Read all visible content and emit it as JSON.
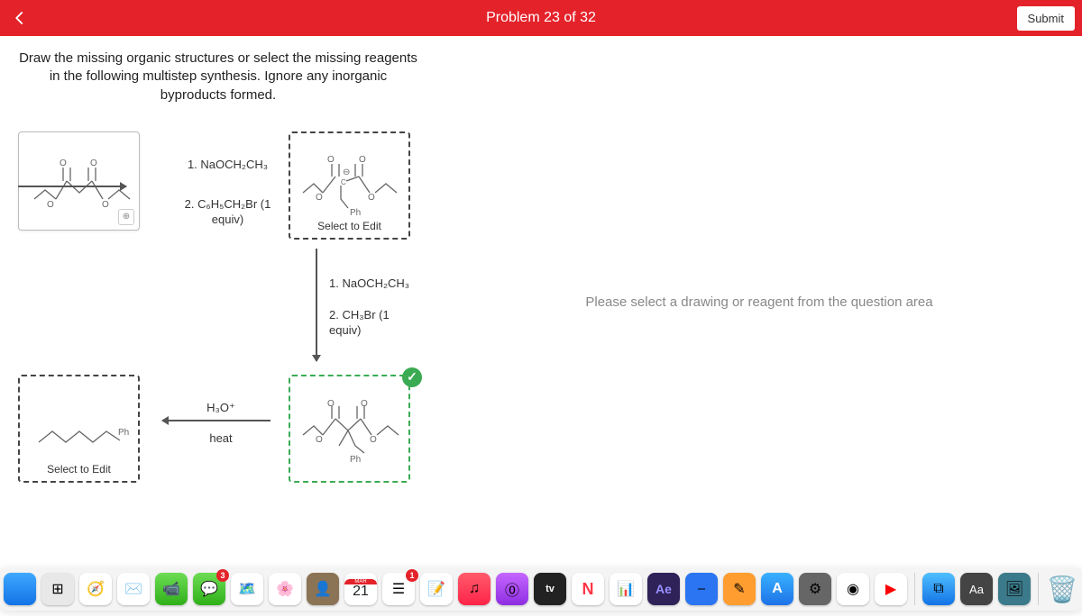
{
  "header": {
    "title": "Problem 23 of 32",
    "submit_label": "Submit"
  },
  "question": {
    "text": "Draw the missing organic structures or select the missing reagents in the following multistep synthesis. Ignore any inorganic byproducts formed."
  },
  "right_panel": {
    "placeholder": "Please select a drawing or reagent from the question area"
  },
  "reagents": {
    "step1_line1": "1. NaOCH₂CH₃",
    "step1_line2": "2. C₆H₅CH₂Br (1 equiv)",
    "step2_line1": "1. NaOCH₂CH₃",
    "step2_line2": "2. CH₃Br (1 equiv)",
    "step3_line1": "H₃O⁺",
    "step3_line2": "heat"
  },
  "labels": {
    "select_to_edit": "Select to Edit",
    "ph": "Ph",
    "o": "O",
    "negative": "⊖"
  },
  "dock": {
    "items": [
      {
        "name": "finder",
        "bg": "linear-gradient(#3ea8ff,#1373e6)",
        "glyph": "",
        "badge": null
      },
      {
        "name": "launchpad",
        "bg": "#e8e8e8",
        "glyph": "⊞",
        "badge": null
      },
      {
        "name": "safari",
        "bg": "#fff",
        "glyph": "🧭",
        "badge": null
      },
      {
        "name": "mail",
        "bg": "#fff",
        "glyph": "✉️",
        "badge": null
      },
      {
        "name": "facetime",
        "bg": "linear-gradient(#6ddc54,#2fb019)",
        "glyph": "📹",
        "badge": null
      },
      {
        "name": "messages",
        "bg": "linear-gradient(#6ddc54,#2fb019)",
        "glyph": "💬",
        "badge": "3"
      },
      {
        "name": "maps",
        "bg": "#fff",
        "glyph": "🗺️",
        "badge": null
      },
      {
        "name": "photos",
        "bg": "#fff",
        "glyph": "🌸",
        "badge": null
      },
      {
        "name": "contacts",
        "bg": "#8b7355",
        "glyph": "👤",
        "badge": null
      },
      {
        "name": "calendar",
        "bg": "#fff",
        "glyph": "",
        "badge": null,
        "month": "MAR",
        "day": "21"
      },
      {
        "name": "reminders",
        "bg": "#fff",
        "glyph": "☰",
        "badge": "1"
      },
      {
        "name": "notes",
        "bg": "#fff",
        "glyph": "📝",
        "badge": null
      },
      {
        "name": "music",
        "bg": "linear-gradient(#ff5c6c,#ff2347)",
        "glyph": "♫",
        "badge": null
      },
      {
        "name": "podcasts",
        "bg": "linear-gradient(#c567ff,#8e2de2)",
        "glyph": "⓪",
        "badge": null
      },
      {
        "name": "tv",
        "bg": "#222",
        "glyph": "tv",
        "badge": null
      },
      {
        "name": "news",
        "bg": "#fff",
        "glyph": "N",
        "badge": null
      },
      {
        "name": "numbers",
        "bg": "#fff",
        "glyph": "📊",
        "badge": null
      },
      {
        "name": "after-effects",
        "bg": "#2e2258",
        "glyph": "Ae",
        "badge": null
      },
      {
        "name": "keynote",
        "bg": "#2b74f2",
        "glyph": "⎯",
        "badge": null
      },
      {
        "name": "pages",
        "bg": "#ff9d30",
        "glyph": "✎",
        "badge": null
      },
      {
        "name": "appstore",
        "bg": "linear-gradient(#38b1ff,#1e73e8)",
        "glyph": "A",
        "badge": null
      },
      {
        "name": "settings",
        "bg": "#666",
        "glyph": "⚙",
        "badge": null
      },
      {
        "name": "chrome",
        "bg": "#fff",
        "glyph": "◉",
        "badge": null
      },
      {
        "name": "youtube",
        "bg": "#fff",
        "glyph": "▶",
        "badge": null
      }
    ],
    "items_after_sep": [
      {
        "name": "screensharing",
        "bg": "linear-gradient(#4fbfff,#1373e6)",
        "glyph": "⧉",
        "badge": null
      },
      {
        "name": "font-book",
        "bg": "#444",
        "glyph": "Aa",
        "badge": null
      },
      {
        "name": "preview",
        "bg": "#3b7a8a",
        "glyph": "🖼",
        "badge": null
      }
    ],
    "trash": {
      "name": "trash",
      "glyph": "🗑️"
    }
  }
}
